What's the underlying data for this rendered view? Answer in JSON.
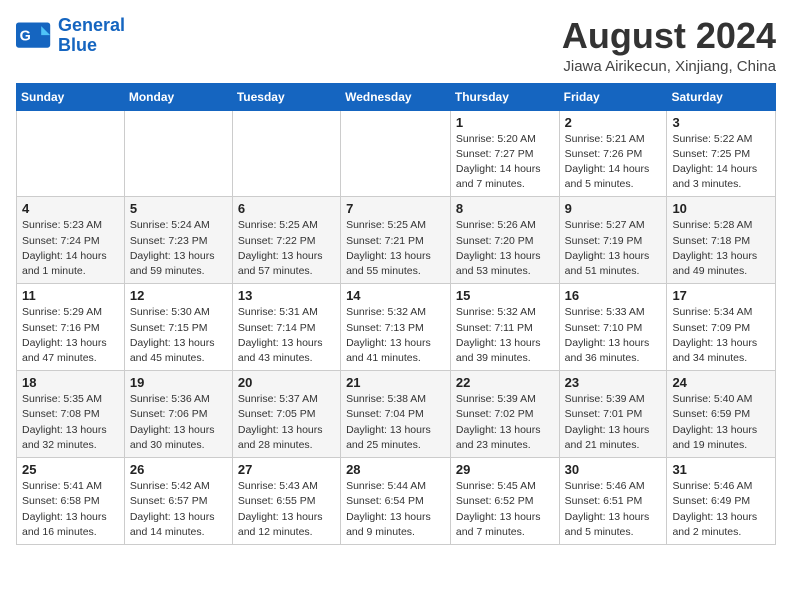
{
  "logo": {
    "text_general": "General",
    "text_blue": "Blue"
  },
  "header": {
    "month_year": "August 2024",
    "location": "Jiawa Airikecun, Xinjiang, China"
  },
  "weekdays": [
    "Sunday",
    "Monday",
    "Tuesday",
    "Wednesday",
    "Thursday",
    "Friday",
    "Saturday"
  ],
  "weeks": [
    [
      {
        "day": "",
        "info": ""
      },
      {
        "day": "",
        "info": ""
      },
      {
        "day": "",
        "info": ""
      },
      {
        "day": "",
        "info": ""
      },
      {
        "day": "1",
        "info": "Sunrise: 5:20 AM\nSunset: 7:27 PM\nDaylight: 14 hours\nand 7 minutes."
      },
      {
        "day": "2",
        "info": "Sunrise: 5:21 AM\nSunset: 7:26 PM\nDaylight: 14 hours\nand 5 minutes."
      },
      {
        "day": "3",
        "info": "Sunrise: 5:22 AM\nSunset: 7:25 PM\nDaylight: 14 hours\nand 3 minutes."
      }
    ],
    [
      {
        "day": "4",
        "info": "Sunrise: 5:23 AM\nSunset: 7:24 PM\nDaylight: 14 hours\nand 1 minute."
      },
      {
        "day": "5",
        "info": "Sunrise: 5:24 AM\nSunset: 7:23 PM\nDaylight: 13 hours\nand 59 minutes."
      },
      {
        "day": "6",
        "info": "Sunrise: 5:25 AM\nSunset: 7:22 PM\nDaylight: 13 hours\nand 57 minutes."
      },
      {
        "day": "7",
        "info": "Sunrise: 5:25 AM\nSunset: 7:21 PM\nDaylight: 13 hours\nand 55 minutes."
      },
      {
        "day": "8",
        "info": "Sunrise: 5:26 AM\nSunset: 7:20 PM\nDaylight: 13 hours\nand 53 minutes."
      },
      {
        "day": "9",
        "info": "Sunrise: 5:27 AM\nSunset: 7:19 PM\nDaylight: 13 hours\nand 51 minutes."
      },
      {
        "day": "10",
        "info": "Sunrise: 5:28 AM\nSunset: 7:18 PM\nDaylight: 13 hours\nand 49 minutes."
      }
    ],
    [
      {
        "day": "11",
        "info": "Sunrise: 5:29 AM\nSunset: 7:16 PM\nDaylight: 13 hours\nand 47 minutes."
      },
      {
        "day": "12",
        "info": "Sunrise: 5:30 AM\nSunset: 7:15 PM\nDaylight: 13 hours\nand 45 minutes."
      },
      {
        "day": "13",
        "info": "Sunrise: 5:31 AM\nSunset: 7:14 PM\nDaylight: 13 hours\nand 43 minutes."
      },
      {
        "day": "14",
        "info": "Sunrise: 5:32 AM\nSunset: 7:13 PM\nDaylight: 13 hours\nand 41 minutes."
      },
      {
        "day": "15",
        "info": "Sunrise: 5:32 AM\nSunset: 7:11 PM\nDaylight: 13 hours\nand 39 minutes."
      },
      {
        "day": "16",
        "info": "Sunrise: 5:33 AM\nSunset: 7:10 PM\nDaylight: 13 hours\nand 36 minutes."
      },
      {
        "day": "17",
        "info": "Sunrise: 5:34 AM\nSunset: 7:09 PM\nDaylight: 13 hours\nand 34 minutes."
      }
    ],
    [
      {
        "day": "18",
        "info": "Sunrise: 5:35 AM\nSunset: 7:08 PM\nDaylight: 13 hours\nand 32 minutes."
      },
      {
        "day": "19",
        "info": "Sunrise: 5:36 AM\nSunset: 7:06 PM\nDaylight: 13 hours\nand 30 minutes."
      },
      {
        "day": "20",
        "info": "Sunrise: 5:37 AM\nSunset: 7:05 PM\nDaylight: 13 hours\nand 28 minutes."
      },
      {
        "day": "21",
        "info": "Sunrise: 5:38 AM\nSunset: 7:04 PM\nDaylight: 13 hours\nand 25 minutes."
      },
      {
        "day": "22",
        "info": "Sunrise: 5:39 AM\nSunset: 7:02 PM\nDaylight: 13 hours\nand 23 minutes."
      },
      {
        "day": "23",
        "info": "Sunrise: 5:39 AM\nSunset: 7:01 PM\nDaylight: 13 hours\nand 21 minutes."
      },
      {
        "day": "24",
        "info": "Sunrise: 5:40 AM\nSunset: 6:59 PM\nDaylight: 13 hours\nand 19 minutes."
      }
    ],
    [
      {
        "day": "25",
        "info": "Sunrise: 5:41 AM\nSunset: 6:58 PM\nDaylight: 13 hours\nand 16 minutes."
      },
      {
        "day": "26",
        "info": "Sunrise: 5:42 AM\nSunset: 6:57 PM\nDaylight: 13 hours\nand 14 minutes."
      },
      {
        "day": "27",
        "info": "Sunrise: 5:43 AM\nSunset: 6:55 PM\nDaylight: 13 hours\nand 12 minutes."
      },
      {
        "day": "28",
        "info": "Sunrise: 5:44 AM\nSunset: 6:54 PM\nDaylight: 13 hours\nand 9 minutes."
      },
      {
        "day": "29",
        "info": "Sunrise: 5:45 AM\nSunset: 6:52 PM\nDaylight: 13 hours\nand 7 minutes."
      },
      {
        "day": "30",
        "info": "Sunrise: 5:46 AM\nSunset: 6:51 PM\nDaylight: 13 hours\nand 5 minutes."
      },
      {
        "day": "31",
        "info": "Sunrise: 5:46 AM\nSunset: 6:49 PM\nDaylight: 13 hours\nand 2 minutes."
      }
    ]
  ]
}
